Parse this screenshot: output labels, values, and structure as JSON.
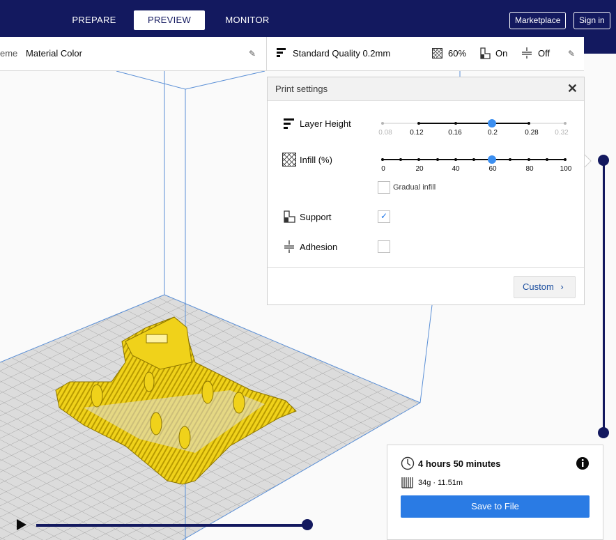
{
  "topbar": {
    "tabs": [
      {
        "label": "PREPARE"
      },
      {
        "label": "PREVIEW"
      },
      {
        "label": "MONITOR"
      }
    ],
    "marketplace_label": "Marketplace",
    "signin_label": "Sign in"
  },
  "colorscheme": {
    "label_partial": "eme",
    "value": "Material Color"
  },
  "quality": {
    "profile": "Standard Quality 0.2mm",
    "infill": "60%",
    "support": "On",
    "adhesion": "Off"
  },
  "print_settings": {
    "title": "Print settings",
    "layer_height": {
      "label": "Layer Height",
      "ticks": [
        "0.08",
        "0.12",
        "0.16",
        "0.2",
        "0.28",
        "0.32"
      ],
      "selected": "0.2"
    },
    "infill": {
      "label": "Infill (%)",
      "ticks": [
        "0",
        "20",
        "40",
        "60",
        "80",
        "100"
      ],
      "selected": 60
    },
    "gradual_infill_label": "Gradual infill",
    "gradual_infill_checked": false,
    "support": {
      "label": "Support",
      "checked": true
    },
    "adhesion": {
      "label": "Adhesion",
      "checked": false
    },
    "custom_label": "Custom"
  },
  "estimate": {
    "time": "4 hours 50 minutes",
    "material": "34g · 11.51m",
    "save_label": "Save to File"
  },
  "colors": {
    "brand": "#13195f",
    "accent": "#2a7be4",
    "slider_handle": "#3c8ff0",
    "model": "#f2d21a"
  }
}
